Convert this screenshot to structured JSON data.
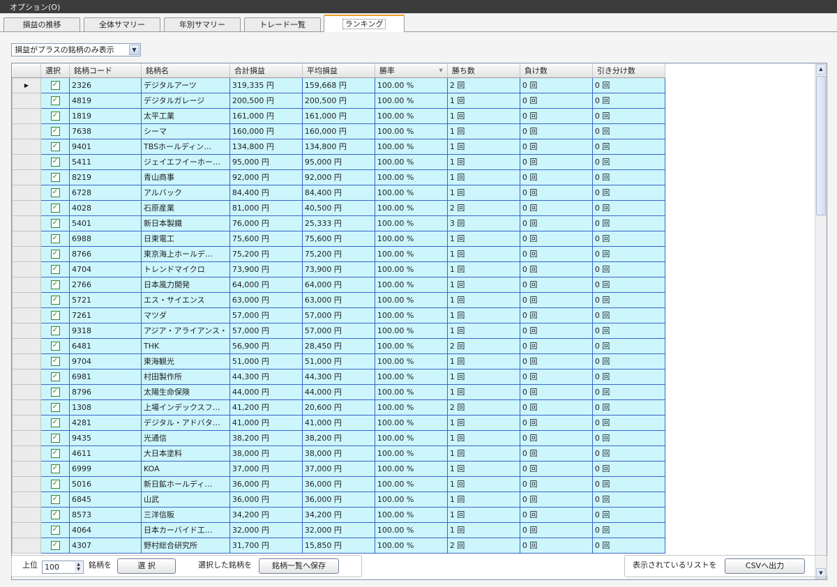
{
  "menu": {
    "options": "オプション(O)"
  },
  "tabs": [
    {
      "label": "損益の推移"
    },
    {
      "label": "全体サマリー"
    },
    {
      "label": "年別サマリー"
    },
    {
      "label": "トレード一覧"
    },
    {
      "label": "ランキング"
    }
  ],
  "active_tab": 4,
  "filter": {
    "selected": "損益がプラスの銘柄のみ表示"
  },
  "columns": [
    "選択",
    "銘柄コード",
    "銘柄名",
    "合計損益",
    "平均損益",
    "勝率",
    "勝ち数",
    "負け数",
    "引き分け数"
  ],
  "current_row_marker": "▶",
  "rows": [
    {
      "code": "2326",
      "name": "デジタルアーツ",
      "total": "319,335 円",
      "avg": "159,668 円",
      "rate": "100.00 %",
      "win": "2 回",
      "lose": "0 回",
      "draw": "0 回"
    },
    {
      "code": "4819",
      "name": "デジタルガレージ",
      "total": "200,500 円",
      "avg": "200,500 円",
      "rate": "100.00 %",
      "win": "1 回",
      "lose": "0 回",
      "draw": "0 回"
    },
    {
      "code": "1819",
      "name": "太平工業",
      "total": "161,000 円",
      "avg": "161,000 円",
      "rate": "100.00 %",
      "win": "1 回",
      "lose": "0 回",
      "draw": "0 回"
    },
    {
      "code": "7638",
      "name": "シーマ",
      "total": "160,000 円",
      "avg": "160,000 円",
      "rate": "100.00 %",
      "win": "1 回",
      "lose": "0 回",
      "draw": "0 回"
    },
    {
      "code": "9401",
      "name": "TBSホールディン…",
      "total": "134,800 円",
      "avg": "134,800 円",
      "rate": "100.00 %",
      "win": "1 回",
      "lose": "0 回",
      "draw": "0 回"
    },
    {
      "code": "5411",
      "name": "ジェイエフイーホー…",
      "total": "95,000 円",
      "avg": "95,000 円",
      "rate": "100.00 %",
      "win": "1 回",
      "lose": "0 回",
      "draw": "0 回"
    },
    {
      "code": "8219",
      "name": "青山商事",
      "total": "92,000 円",
      "avg": "92,000 円",
      "rate": "100.00 %",
      "win": "1 回",
      "lose": "0 回",
      "draw": "0 回"
    },
    {
      "code": "6728",
      "name": "アルバック",
      "total": "84,400 円",
      "avg": "84,400 円",
      "rate": "100.00 %",
      "win": "1 回",
      "lose": "0 回",
      "draw": "0 回"
    },
    {
      "code": "4028",
      "name": "石原産業",
      "total": "81,000 円",
      "avg": "40,500 円",
      "rate": "100.00 %",
      "win": "2 回",
      "lose": "0 回",
      "draw": "0 回"
    },
    {
      "code": "5401",
      "name": "新日本製鐵",
      "total": "76,000 円",
      "avg": "25,333 円",
      "rate": "100.00 %",
      "win": "3 回",
      "lose": "0 回",
      "draw": "0 回"
    },
    {
      "code": "6988",
      "name": "日東電工",
      "total": "75,600 円",
      "avg": "75,600 円",
      "rate": "100.00 %",
      "win": "1 回",
      "lose": "0 回",
      "draw": "0 回"
    },
    {
      "code": "8766",
      "name": "東京海上ホールデ…",
      "total": "75,200 円",
      "avg": "75,200 円",
      "rate": "100.00 %",
      "win": "1 回",
      "lose": "0 回",
      "draw": "0 回"
    },
    {
      "code": "4704",
      "name": "トレンドマイクロ",
      "total": "73,900 円",
      "avg": "73,900 円",
      "rate": "100.00 %",
      "win": "1 回",
      "lose": "0 回",
      "draw": "0 回"
    },
    {
      "code": "2766",
      "name": "日本風力開発",
      "total": "64,000 円",
      "avg": "64,000 円",
      "rate": "100.00 %",
      "win": "1 回",
      "lose": "0 回",
      "draw": "0 回"
    },
    {
      "code": "5721",
      "name": "エス・サイエンス",
      "total": "63,000 円",
      "avg": "63,000 円",
      "rate": "100.00 %",
      "win": "1 回",
      "lose": "0 回",
      "draw": "0 回"
    },
    {
      "code": "7261",
      "name": "マツダ",
      "total": "57,000 円",
      "avg": "57,000 円",
      "rate": "100.00 %",
      "win": "1 回",
      "lose": "0 回",
      "draw": "0 回"
    },
    {
      "code": "9318",
      "name": "アジア・アライアンス・",
      "total": "57,000 円",
      "avg": "57,000 円",
      "rate": "100.00 %",
      "win": "1 回",
      "lose": "0 回",
      "draw": "0 回"
    },
    {
      "code": "6481",
      "name": "THK",
      "total": "56,900 円",
      "avg": "28,450 円",
      "rate": "100.00 %",
      "win": "2 回",
      "lose": "0 回",
      "draw": "0 回"
    },
    {
      "code": "9704",
      "name": "東海観光",
      "total": "51,000 円",
      "avg": "51,000 円",
      "rate": "100.00 %",
      "win": "1 回",
      "lose": "0 回",
      "draw": "0 回"
    },
    {
      "code": "6981",
      "name": "村田製作所",
      "total": "44,300 円",
      "avg": "44,300 円",
      "rate": "100.00 %",
      "win": "1 回",
      "lose": "0 回",
      "draw": "0 回"
    },
    {
      "code": "8796",
      "name": "太陽生命保険",
      "total": "44,000 円",
      "avg": "44,000 円",
      "rate": "100.00 %",
      "win": "1 回",
      "lose": "0 回",
      "draw": "0 回"
    },
    {
      "code": "1308",
      "name": "上場インデックスフ…",
      "total": "41,200 円",
      "avg": "20,600 円",
      "rate": "100.00 %",
      "win": "2 回",
      "lose": "0 回",
      "draw": "0 回"
    },
    {
      "code": "4281",
      "name": "デジタル・アドバタ…",
      "total": "41,000 円",
      "avg": "41,000 円",
      "rate": "100.00 %",
      "win": "1 回",
      "lose": "0 回",
      "draw": "0 回"
    },
    {
      "code": "9435",
      "name": "光通信",
      "total": "38,200 円",
      "avg": "38,200 円",
      "rate": "100.00 %",
      "win": "1 回",
      "lose": "0 回",
      "draw": "0 回"
    },
    {
      "code": "4611",
      "name": "大日本塗料",
      "total": "38,000 円",
      "avg": "38,000 円",
      "rate": "100.00 %",
      "win": "1 回",
      "lose": "0 回",
      "draw": "0 回"
    },
    {
      "code": "6999",
      "name": "KOA",
      "total": "37,000 円",
      "avg": "37,000 円",
      "rate": "100.00 %",
      "win": "1 回",
      "lose": "0 回",
      "draw": "0 回"
    },
    {
      "code": "5016",
      "name": "新日鉱ホールディ…",
      "total": "36,000 円",
      "avg": "36,000 円",
      "rate": "100.00 %",
      "win": "1 回",
      "lose": "0 回",
      "draw": "0 回"
    },
    {
      "code": "6845",
      "name": "山武",
      "total": "36,000 円",
      "avg": "36,000 円",
      "rate": "100.00 %",
      "win": "1 回",
      "lose": "0 回",
      "draw": "0 回"
    },
    {
      "code": "8573",
      "name": "三洋信販",
      "total": "34,200 円",
      "avg": "34,200 円",
      "rate": "100.00 %",
      "win": "1 回",
      "lose": "0 回",
      "draw": "0 回"
    },
    {
      "code": "4064",
      "name": "日本カーバイド工…",
      "total": "32,000 円",
      "avg": "32,000 円",
      "rate": "100.00 %",
      "win": "1 回",
      "lose": "0 回",
      "draw": "0 回"
    },
    {
      "code": "4307",
      "name": "野村総合研究所",
      "total": "31,700 円",
      "avg": "15,850 円",
      "rate": "100.00 %",
      "win": "2 回",
      "lose": "0 回",
      "draw": "0 回"
    }
  ],
  "bottom": {
    "top_label": "上位",
    "top_value": "100",
    "stocks_label": "銘柄を",
    "select_button": "選 択",
    "selected_label": "選択した銘柄を",
    "save_button": "銘柄一覧へ保存",
    "list_label": "表示されているリストを",
    "csv_button": "CSVへ出力"
  },
  "colors": {
    "row_bg": "#ccf6fc",
    "cell_border": "#3a64c8",
    "tab_accent": "#f0a020"
  }
}
